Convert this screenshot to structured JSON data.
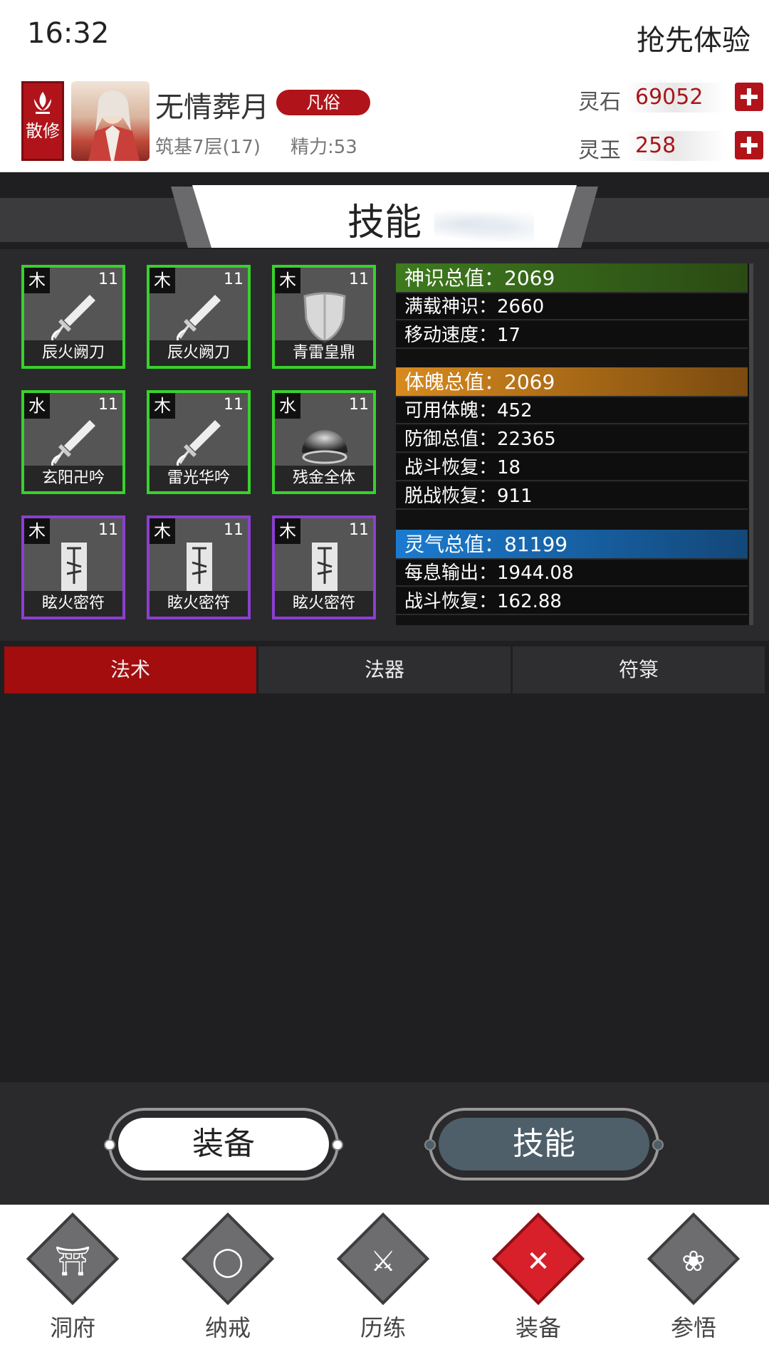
{
  "status": {
    "time": "16:32",
    "right": "抢先体验"
  },
  "profile": {
    "sect": "散修",
    "name": "无情葬月",
    "rank": "凡俗",
    "realm": "筑基7层(17)",
    "energy": "精力:53"
  },
  "currencies": [
    {
      "label": "灵石",
      "value": "69052"
    },
    {
      "label": "灵玉",
      "value": "258"
    }
  ],
  "title": "技能",
  "skills": [
    {
      "element": "木",
      "level": "11",
      "name": "辰火阙刀",
      "border": "green",
      "icon": "sword-icon"
    },
    {
      "element": "木",
      "level": "11",
      "name": "辰火阙刀",
      "border": "green",
      "icon": "sword-icon"
    },
    {
      "element": "木",
      "level": "11",
      "name": "青雷皇鼎",
      "border": "green",
      "icon": "shield-icon"
    },
    {
      "element": "水",
      "level": "11",
      "name": "玄阳卍吟",
      "border": "green",
      "icon": "sword-icon"
    },
    {
      "element": "木",
      "level": "11",
      "name": "雷光华吟",
      "border": "green",
      "icon": "sword-icon"
    },
    {
      "element": "水",
      "level": "11",
      "name": "残金全体",
      "border": "green",
      "icon": "orb-icon"
    },
    {
      "element": "木",
      "level": "11",
      "name": "眩火密符",
      "border": "purple",
      "icon": "talisman-icon"
    },
    {
      "element": "木",
      "level": "11",
      "name": "眩火密符",
      "border": "purple",
      "icon": "talisman-icon"
    },
    {
      "element": "木",
      "level": "11",
      "name": "眩火密符",
      "border": "purple",
      "icon": "talisman-icon"
    }
  ],
  "stats": {
    "shenshi_head": "神识总值：2069",
    "shenshi": [
      "满载神识：2660",
      "移动速度：17"
    ],
    "tipo_head": "体魄总值：2069",
    "tipo": [
      "可用体魄：452",
      "防御总值：22365",
      "战斗恢复：18",
      "脱战恢复：911"
    ],
    "lingqi_head": "灵气总值：81199",
    "lingqi": [
      "每息输出：1944.08",
      "战斗恢复：162.88"
    ]
  },
  "tabs": [
    "法术",
    "法器",
    "符箓"
  ],
  "toggles": {
    "equip": "装备",
    "skill": "技能"
  },
  "nav": [
    {
      "label": "洞府",
      "icon": "gate-icon"
    },
    {
      "label": "纳戒",
      "icon": "ring-icon"
    },
    {
      "label": "历练",
      "icon": "crossed-swords-icon"
    },
    {
      "label": "装备",
      "icon": "equipment-icon"
    },
    {
      "label": "参悟",
      "icon": "lotus-icon"
    }
  ],
  "colors": {
    "accent": "#a30d0e",
    "skill_green": "#38d12c",
    "skill_purple": "#8b3fd0"
  }
}
